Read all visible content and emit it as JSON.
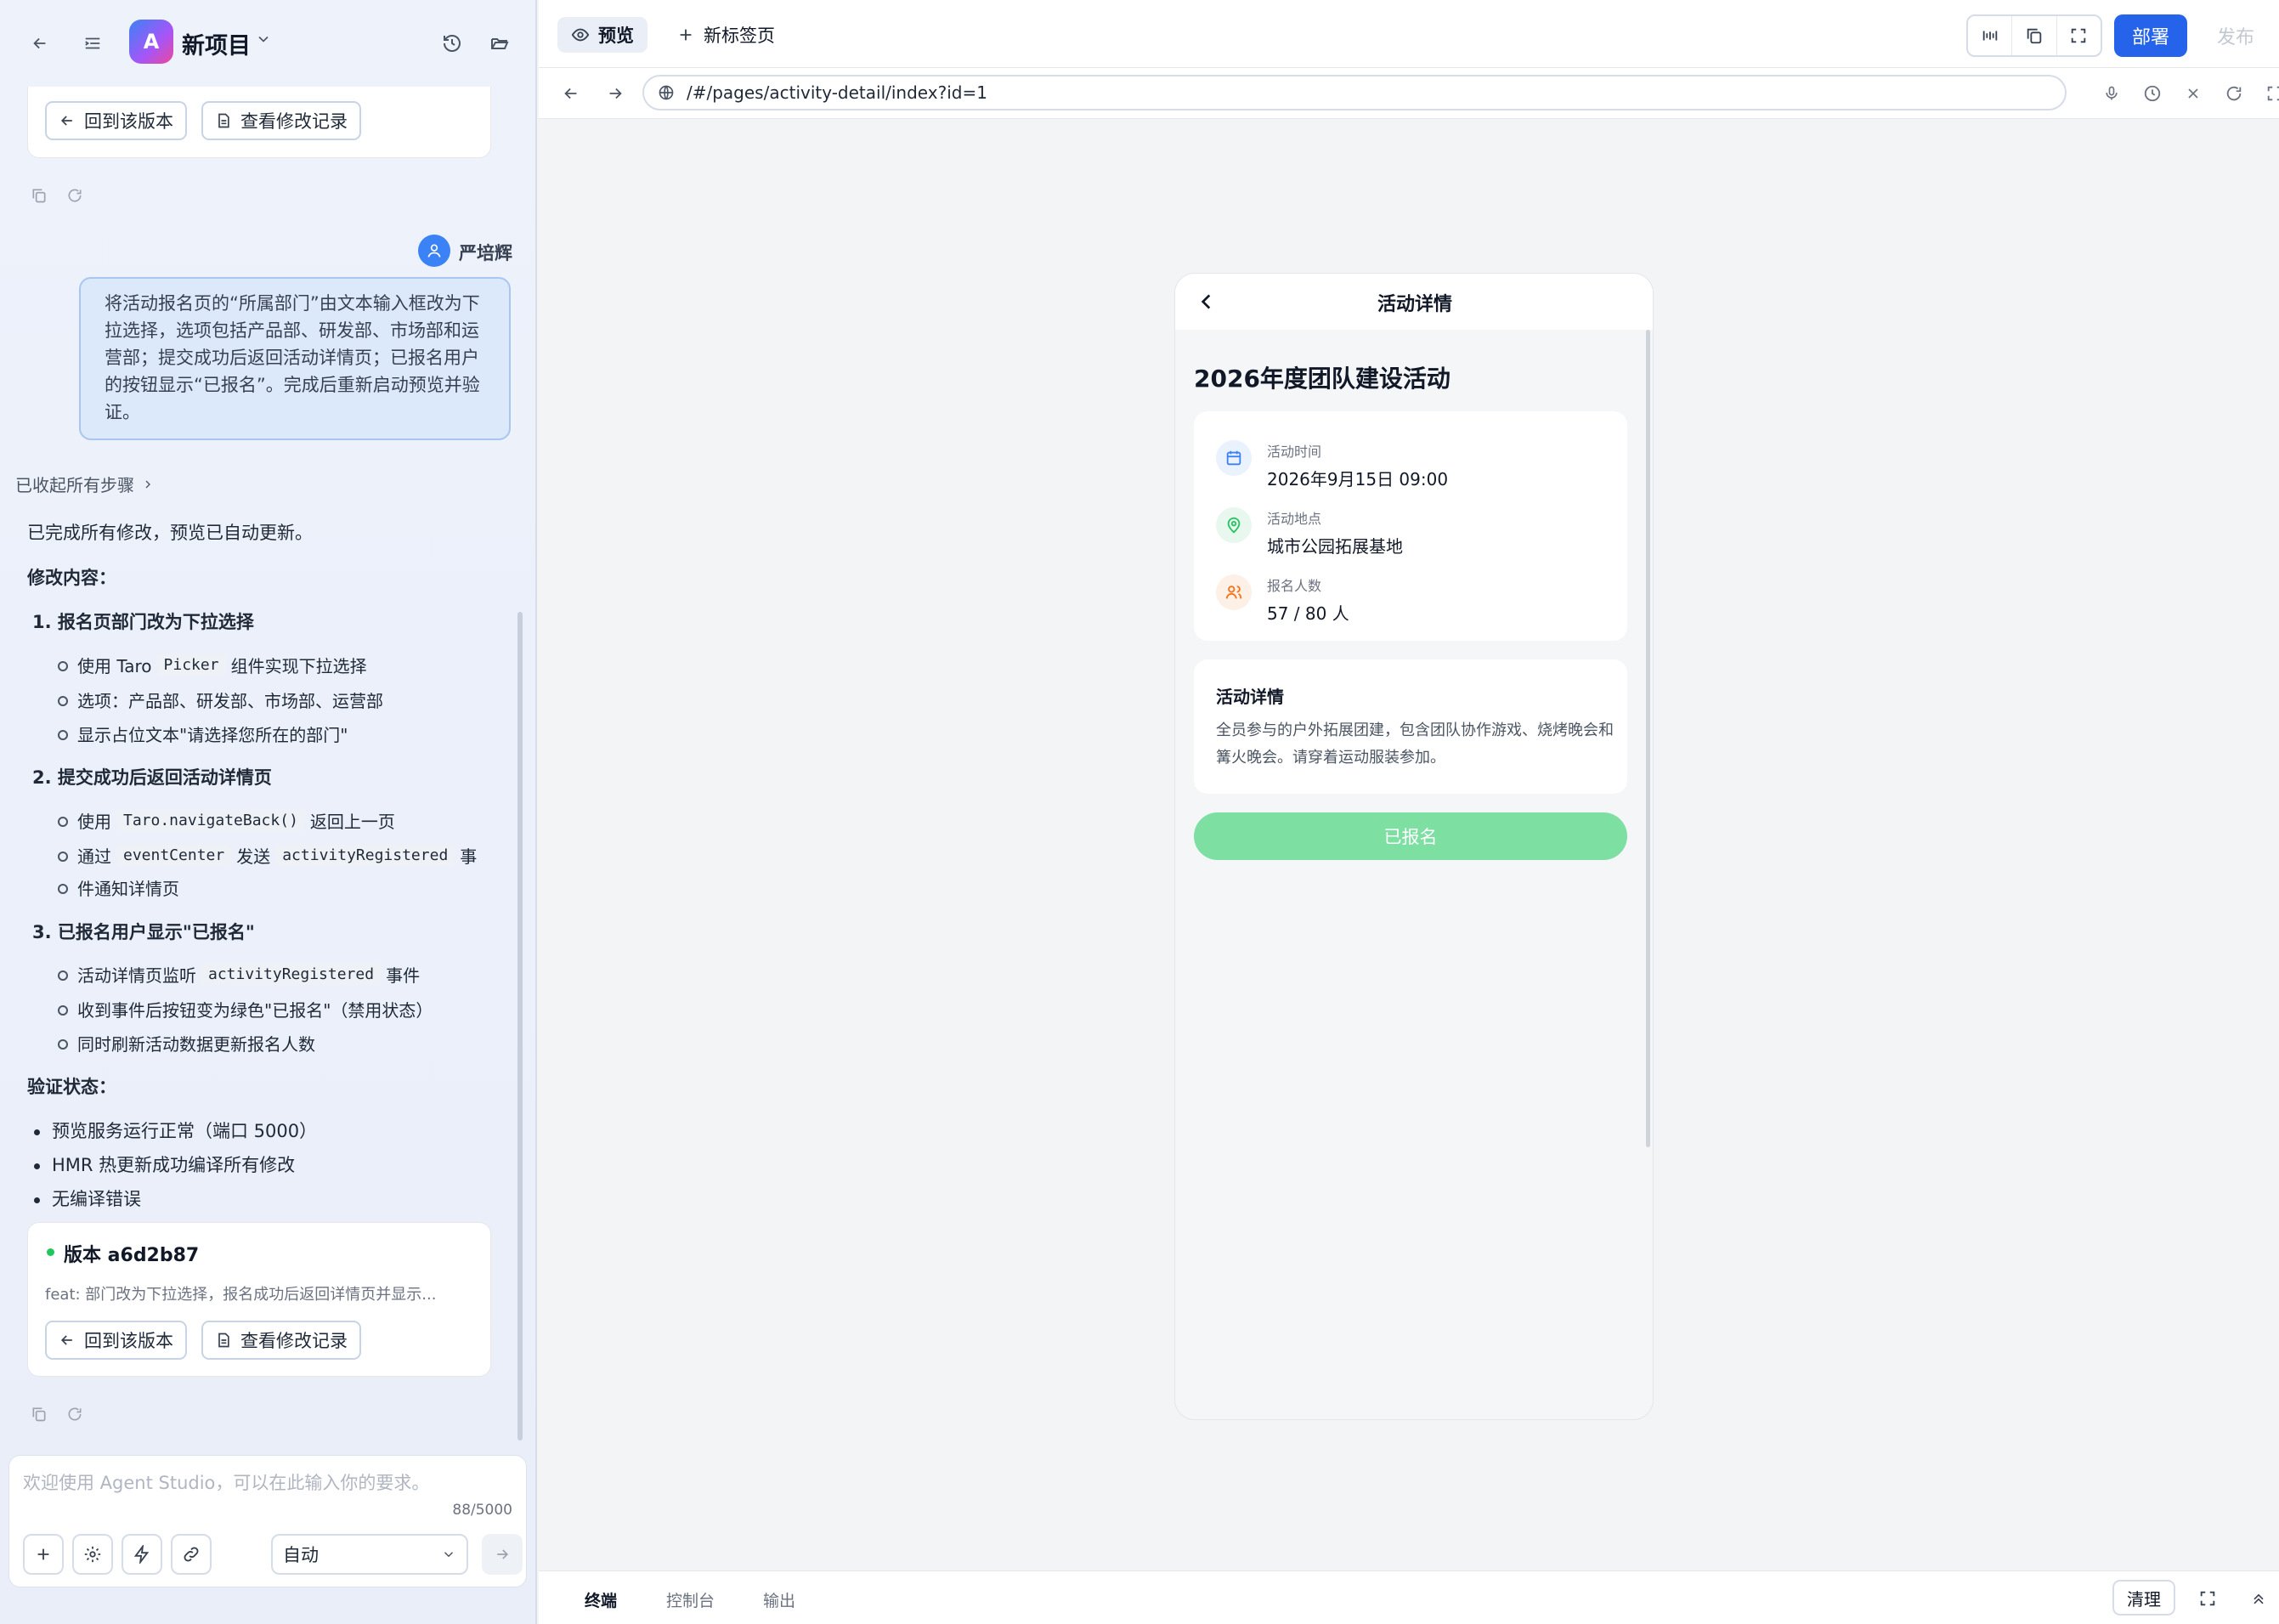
{
  "project": {
    "logo_letter": "A",
    "name": "新项目"
  },
  "version_card_top": {
    "revert_label": "回到该版本",
    "history_label": "查看修改记录"
  },
  "user": {
    "name": "严培辉",
    "message": "将活动报名页的“所属部门”由文本输入框改为下拉选择，选项包括产品部、研发部、市场部和运营部；提交成功后返回活动详情页；已报名用户的按钮显示“已报名”。完成后重新启动预览并验证。"
  },
  "assistant": {
    "collapsed_label": "已收起所有步骤",
    "intro": "已完成所有修改，预览已自动更新。",
    "changes_heading": "修改内容：",
    "item1": {
      "title": "1. 报名页部门改为下拉选择",
      "s1a": "使用 Taro",
      "s1code": "Picker",
      "s1b": "组件实现下拉选择",
      "s2": "选项：产品部、研发部、市场部、运营部",
      "s3": "显示占位文本\"请选择您所在的部门\""
    },
    "item2": {
      "title": "2. 提交成功后返回活动详情页",
      "s1a": "使用",
      "s1code": "Taro.navigateBack()",
      "s1b": "返回上一页",
      "s2a": "通过",
      "s2code1": "eventCenter",
      "s2b": "发送",
      "s2code2": "activityRegistered",
      "s2c": "事",
      "s2d": "件通知详情页"
    },
    "item3": {
      "title": "3. 已报名用户显示\"已报名\"",
      "s1a": "活动详情页监听",
      "s1code": "activityRegistered",
      "s1b": "事件",
      "s2": "收到事件后按钮变为绿色\"已报名\"（禁用状态）",
      "s3": "同时刷新活动数据更新报名人数"
    },
    "verify_heading": "验证状态：",
    "verify": [
      "预览服务运行正常（端口 5000）",
      "HMR 热更新成功编译所有修改",
      "无编译错误"
    ],
    "version": {
      "title": "版本 a6d2b87",
      "desc": "feat: 部门改为下拉选择，报名成功后返回详情页并显示...",
      "revert_label": "回到该版本",
      "history_label": "查看修改记录"
    }
  },
  "input": {
    "placeholder": "欢迎使用 Agent Studio，可以在此输入你的要求。",
    "counter": "88/5000",
    "mode": "自动"
  },
  "tabs": {
    "preview": "预览",
    "new_tab": "新标签页"
  },
  "actions": {
    "deploy": "部署",
    "publish": "发布"
  },
  "address": {
    "url": "/#/pages/activity-detail/index?id=1"
  },
  "phone": {
    "nav_title": "活动详情",
    "event_title": "2026年度团队建设活动",
    "info": [
      {
        "icon": "calendar-icon",
        "label": "活动时间",
        "value": "2026年9月15日 09:00",
        "color": "#3b82f6"
      },
      {
        "icon": "location-icon",
        "label": "活动地点",
        "value": "城市公园拓展基地",
        "color": "#22c55e"
      },
      {
        "icon": "users-icon",
        "label": "报名人数",
        "value": "57 / 80 人",
        "color": "#f97316"
      }
    ],
    "details_title": "活动详情",
    "details_text": "全员参与的户外拓展团建，包含团队协作游戏、烧烤晚会和篝火晚会。请穿着运动服装参加。",
    "button_label": "已报名",
    "button_color": "#7edfa3"
  },
  "bottom": {
    "tabs": [
      "终端",
      "控制台",
      "输出"
    ],
    "clear": "清理"
  },
  "colors": {
    "accent": "#2563eb"
  }
}
